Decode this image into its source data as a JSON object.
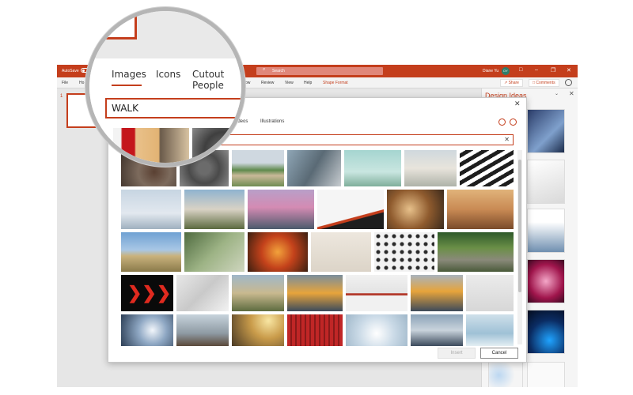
{
  "titlebar": {
    "autosave_label": "AutoSave",
    "search_placeholder": "Search",
    "user_name": "Diane Yu",
    "user_initials": "DY"
  },
  "ribbon": {
    "tabs": [
      "File",
      "Ho",
      "ow",
      "Review",
      "View",
      "Help",
      "Shape Format"
    ],
    "share_label": "Share",
    "comments_label": "Comments"
  },
  "thumbnails": {
    "slide_number": "1"
  },
  "design_ideas": {
    "title": "Design Ideas"
  },
  "dialog": {
    "tabs": [
      "ideos",
      "Illustrations"
    ],
    "search_value": "",
    "insert_label": "Insert",
    "cancel_label": "Cancel"
  },
  "magnifier": {
    "tabs": [
      "Images",
      "Icons",
      "Cutout People"
    ],
    "search_value": "WALK"
  },
  "colors": {
    "accent": "#c43e1c",
    "titlebar": "#c43e1c"
  }
}
